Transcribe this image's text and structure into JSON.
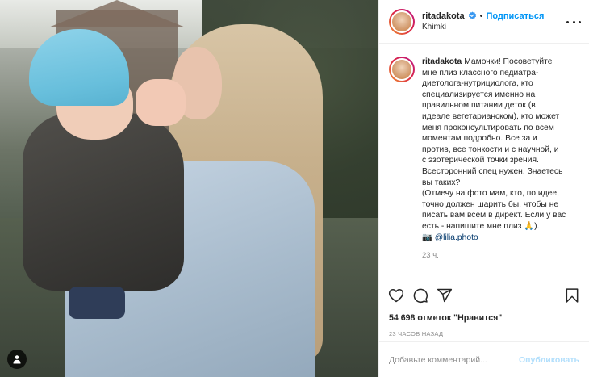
{
  "post": {
    "username": "ritadakota",
    "location": "Khimki",
    "follow_label": "Подписаться",
    "dot": "•",
    "caption": {
      "username": "ritadakota",
      "lines": [
        "Мамочки! Посоветуйте",
        "мне плиз классного педиатра-",
        "диетолога-нутрициолога, кто",
        "специализируется именно на",
        "правильном питании деток (в",
        "идеале вегетарианском), кто может",
        "меня проконсультировать по всем",
        "моментам подробно. Все за и",
        "против, все тонкости и с научной, и",
        "с эзотерической точки зрения.",
        "Всесторонний спец нужен. Знаетесь",
        "вы таких?",
        "(Отмечу на фото мам, кто, по идее,",
        "точно должен шарить бы, чтобы не",
        "писать вам всем в директ. Если у вас",
        "есть - напишите мне плиз"
      ],
      "last_line_suffix": ").",
      "pray_emoji": "🙏",
      "camera_emoji": "📷",
      "mention": "@lilia.photo"
    },
    "caption_time": "23 ч.",
    "likes_text": "54 698 отметок \"Нравится\"",
    "posted_ago": "23 часов назад",
    "comment_placeholder": "Добавьте комментарий...",
    "publish_label": "Опубликовать"
  },
  "colors": {
    "accent": "#0095f6",
    "verified": "#3897f0",
    "publish_disabled": "#b2dffc",
    "muted": "#8e8e8e"
  },
  "icons": [
    "person-tag-icon",
    "verified-badge-icon",
    "more-icon",
    "heart-icon",
    "comment-icon",
    "share-icon",
    "bookmark-icon"
  ]
}
